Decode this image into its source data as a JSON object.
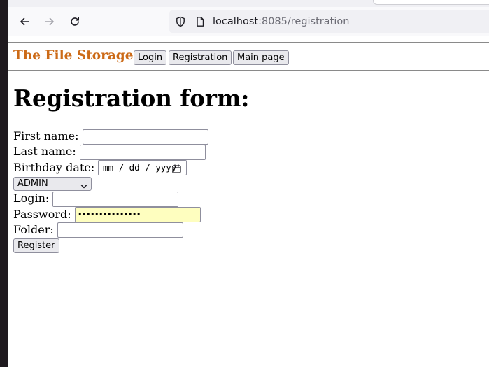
{
  "browser": {
    "url_host": "localhost",
    "url_path": ":8085/registration"
  },
  "nav": {
    "brand": "The File Storage",
    "login_label": "Login",
    "registration_label": "Registration",
    "main_page_label": "Main page"
  },
  "form": {
    "heading": "Registration form:",
    "first_name_label": "First name:",
    "last_name_label": "Last name:",
    "birthday_label": "Birthday date:",
    "birthday_placeholder": "mm / dd / yyyy",
    "role_selected": "ADMIN",
    "login_label": "Login:",
    "password_label": "Password:",
    "password_value": "•••••••••••••••",
    "folder_label": "Folder:",
    "register_label": "Register"
  },
  "colors": {
    "brand": "#cc6a17",
    "password_autofill_bg": "#fefebf"
  },
  "icons": [
    "back-arrow-icon",
    "forward-arrow-icon",
    "reload-icon",
    "shield-icon",
    "page-icon",
    "calendar-icon",
    "chevron-down-icon"
  ]
}
